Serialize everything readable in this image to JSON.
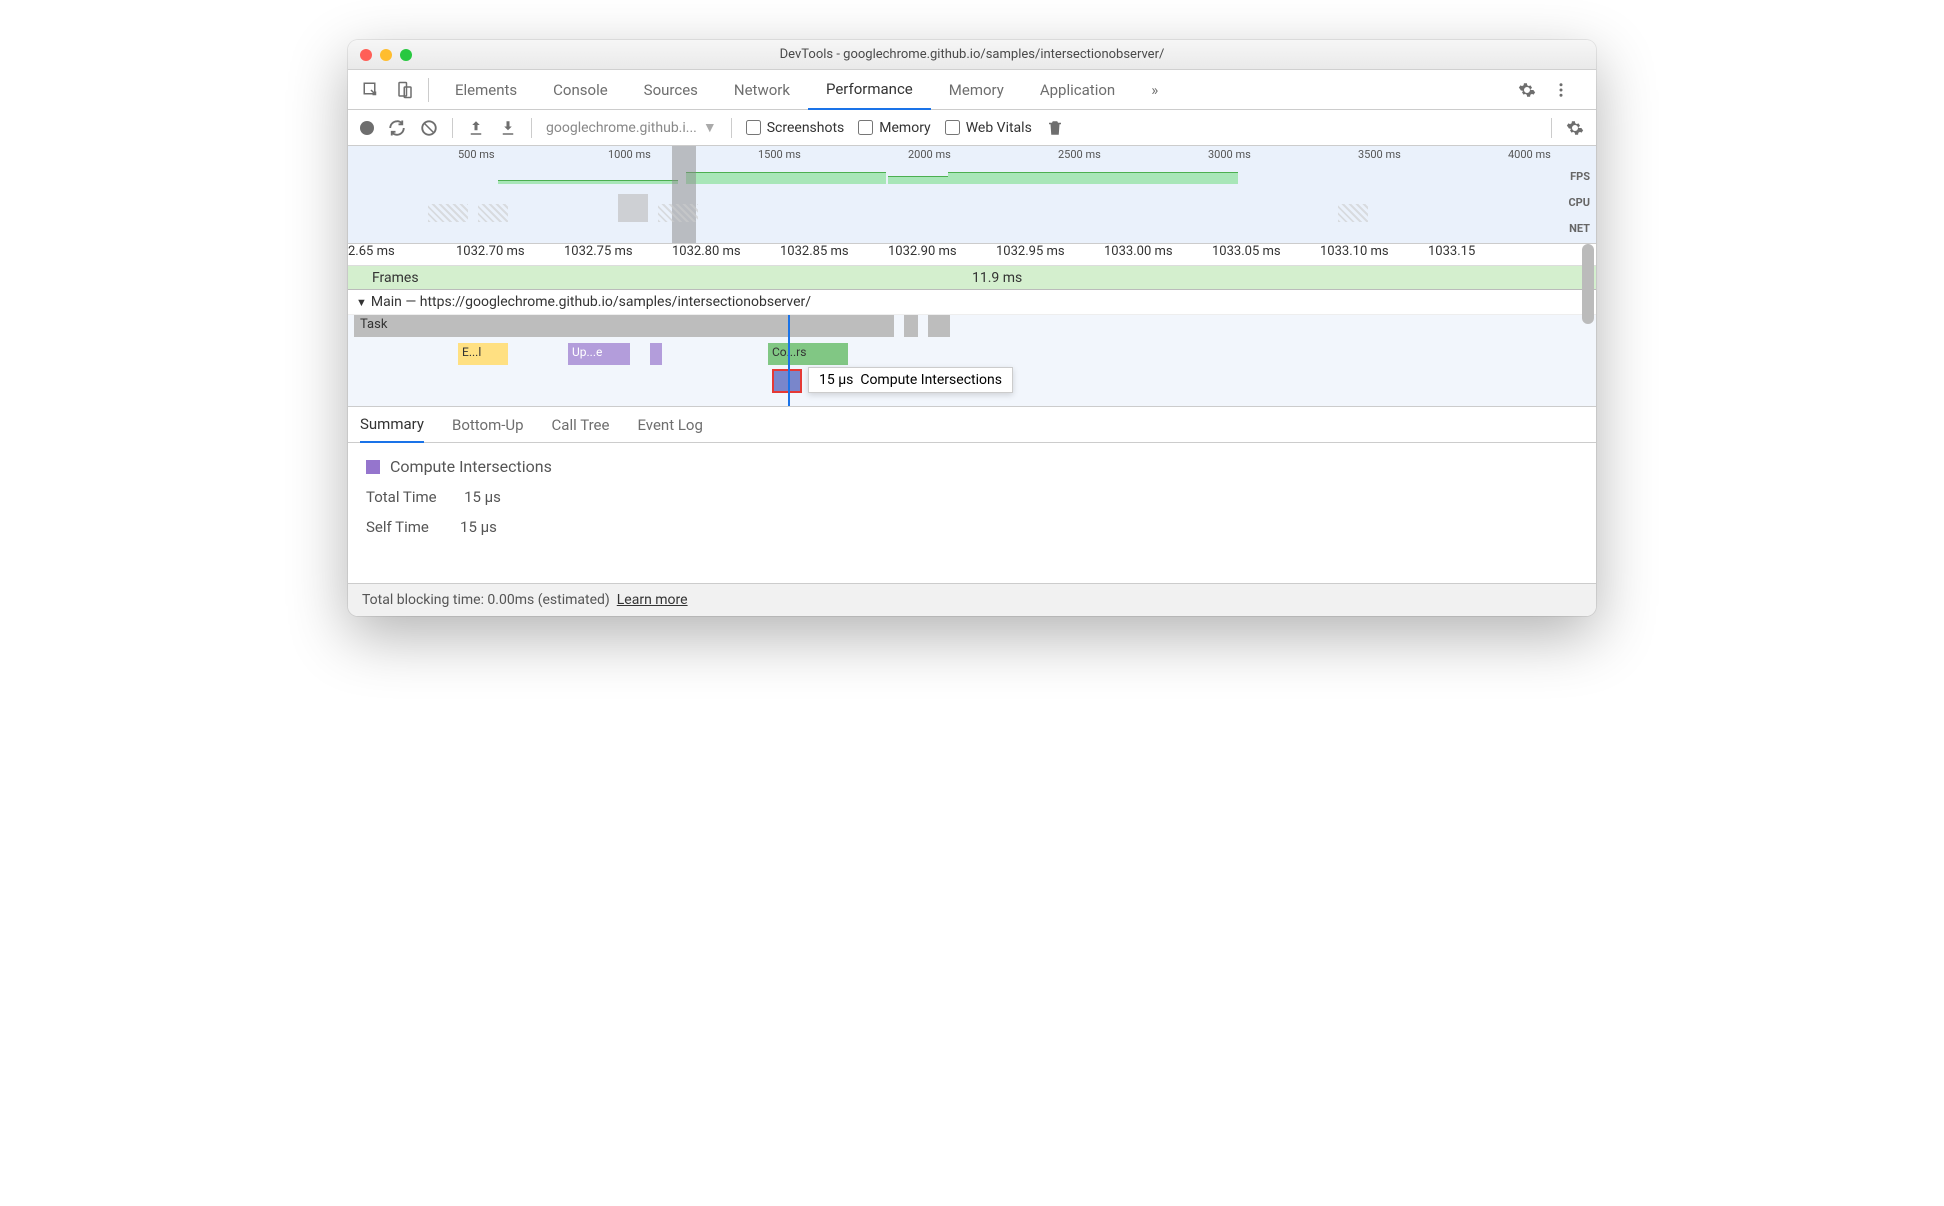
{
  "titlebar": {
    "title": "DevTools - googlechrome.github.io/samples/intersectionobserver/"
  },
  "tabs": {
    "items": [
      "Elements",
      "Console",
      "Sources",
      "Network",
      "Performance",
      "Memory",
      "Application"
    ],
    "active": 4,
    "more": "»"
  },
  "toolbar": {
    "url": "googlechrome.github.i...",
    "screenshots": "Screenshots",
    "memory": "Memory",
    "webvitals": "Web Vitals"
  },
  "overview": {
    "ticks": [
      "500 ms",
      "1000 ms",
      "1500 ms",
      "2000 ms",
      "2500 ms",
      "3000 ms",
      "3500 ms",
      "4000 ms"
    ],
    "labels": [
      "FPS",
      "CPU",
      "NET"
    ]
  },
  "detail_ticks": [
    "2.65 ms",
    "1032.70 ms",
    "1032.75 ms",
    "1032.80 ms",
    "1032.85 ms",
    "1032.90 ms",
    "1032.95 ms",
    "1033.00 ms",
    "1033.05 ms",
    "1033.10 ms",
    "1033.15"
  ],
  "frames": {
    "label": "Frames",
    "value": "11.9 ms"
  },
  "main": {
    "label": "Main — https://googlechrome.github.io/samples/intersectionobserver/"
  },
  "flame": {
    "task": "Task",
    "ev_yellow": "E...l",
    "ev_purple": "Up...e",
    "ev_green": "Co...rs",
    "tooltip_time": "15 µs",
    "tooltip_name": "Compute Intersections"
  },
  "bottom_tabs": {
    "items": [
      "Summary",
      "Bottom-Up",
      "Call Tree",
      "Event Log"
    ],
    "active": 0
  },
  "summary": {
    "name": "Compute Intersections",
    "total_label": "Total Time",
    "total_value": "15 µs",
    "self_label": "Self Time",
    "self_value": "15 µs"
  },
  "footer": {
    "text": "Total blocking time: 0.00ms (estimated)",
    "link": "Learn more"
  }
}
